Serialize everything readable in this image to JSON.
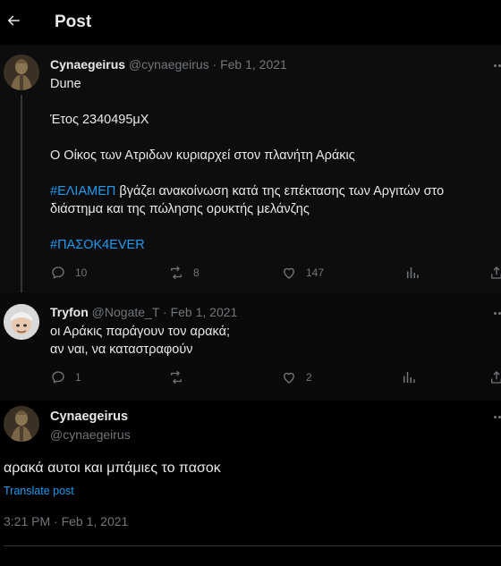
{
  "header": {
    "title": "Post"
  },
  "tweets": [
    {
      "display_name": "Cynaegeirus",
      "handle": "@cynaegeirus",
      "separator": "·",
      "date": "Feb 1, 2021",
      "lines": {
        "l1": "Dune",
        "l2": "Έτος 2340495μΧ",
        "l3": "Ο Οίκος των Ατριδων κυριαρχεί στον πλανήτη Αράκις",
        "hashtag1": "#ΕΛΙΑΜΕΠ",
        "l4_rest": " βγάζει ανακοίνωση κατά της επέκτασης των Αργιτών στο διάστημα και της πώλησης ορυκτής μελάνζης",
        "hashtag2": "#ΠΑΣΟΚ4EVER"
      },
      "stats": {
        "replies": "10",
        "reposts": "8",
        "likes": "147"
      }
    },
    {
      "display_name": "Tryfon",
      "handle": "@Nogate_T",
      "separator": "·",
      "date": "Feb 1, 2021",
      "lines": {
        "l1": "οι Αράκις παράγουν τον αρακά;",
        "l2": "αν ναι, να καταστραφούν"
      },
      "stats": {
        "replies": "1",
        "reposts": "",
        "likes": "2"
      }
    }
  ],
  "main": {
    "display_name": "Cynaegeirus",
    "handle": "@cynaegeirus",
    "text": "αρακά αυτοι και μπάμιες το πασοκ",
    "translate": "Translate post",
    "timestamp": "3:21 PM · Feb 1, 2021"
  },
  "colors": {
    "accent": "#1d9bf0",
    "muted": "#71767b",
    "text": "#e7e9ea",
    "background": "#000000"
  },
  "icons": [
    "back-arrow-icon",
    "more-icon",
    "reply-icon",
    "repost-icon",
    "like-icon",
    "views-icon",
    "share-icon"
  ]
}
